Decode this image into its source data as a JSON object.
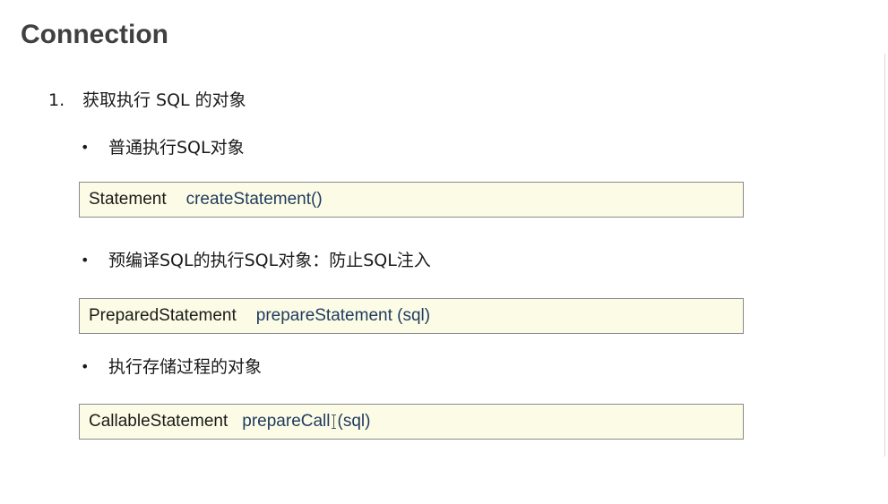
{
  "slide": {
    "title": "Connection",
    "list_number": "1.",
    "list_text": "获取执行 SQL 的对象",
    "items": [
      {
        "bullet": "•",
        "text": "普通执行SQL对象",
        "code_type": "Statement",
        "code_method": "createStatement()"
      },
      {
        "bullet": "•",
        "text": "预编译SQL的执行SQL对象：防止SQL注入",
        "code_type": "PreparedStatement",
        "code_method": "prepareStatement (sql)"
      },
      {
        "bullet": "•",
        "text": "执行存储过程的对象",
        "code_type": "CallableStatement",
        "code_method_a": "prepareCall",
        "code_method_b": "(sql)"
      }
    ]
  },
  "colors": {
    "title": "#404040",
    "code_box_bg": "#fcfce6",
    "code_box_border": "#8a8a8a",
    "method_text": "#1f3a5f"
  },
  "icons": {
    "text_cursor": "text-cursor-icon"
  }
}
